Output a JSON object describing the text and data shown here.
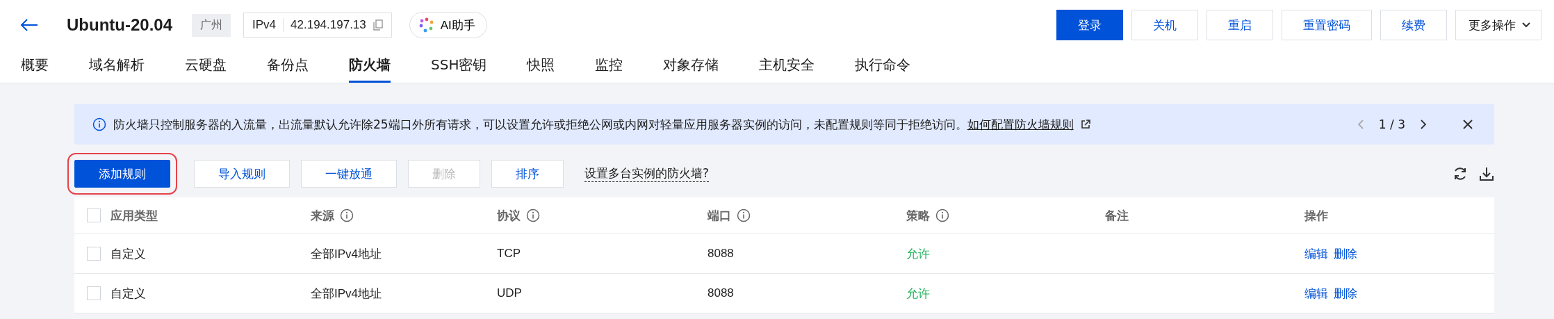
{
  "header": {
    "title": "Ubuntu-20.04",
    "region": "广州",
    "ip_label": "IPv4",
    "ip": "42.194.197.13",
    "assistant": "AI助手",
    "actions": [
      {
        "label": "登录",
        "kind": "primary"
      },
      {
        "label": "关机",
        "kind": "default"
      },
      {
        "label": "重启",
        "kind": "default"
      },
      {
        "label": "重置密码",
        "kind": "default"
      },
      {
        "label": "续费",
        "kind": "default"
      },
      {
        "label": "更多操作",
        "kind": "dropdown"
      }
    ]
  },
  "tabs": [
    {
      "label": "概要",
      "selected": false
    },
    {
      "label": "域名解析",
      "selected": false
    },
    {
      "label": "云硬盘",
      "selected": false
    },
    {
      "label": "备份点",
      "selected": false
    },
    {
      "label": "防火墙",
      "selected": true
    },
    {
      "label": "SSH密钥",
      "selected": false
    },
    {
      "label": "快照",
      "selected": false
    },
    {
      "label": "监控",
      "selected": false
    },
    {
      "label": "对象存储",
      "selected": false
    },
    {
      "label": "主机安全",
      "selected": false
    },
    {
      "label": "执行命令",
      "selected": false
    }
  ],
  "notice": {
    "text": "防火墙只控制服务器的入流量，出流量默认允许除25端口外所有请求，可以设置允许或拒绝公网或内网对轻量应用服务器实例的访问，未配置规则等同于拒绝访问。",
    "link": "如何配置防火墙规则",
    "pager": "1 / 3"
  },
  "toolbar": {
    "buttons": [
      {
        "label": "添加规则",
        "kind": "primary",
        "disabled": false,
        "highlighted": true
      },
      {
        "label": "导入规则",
        "kind": "default",
        "disabled": false,
        "highlighted": false
      },
      {
        "label": "一键放通",
        "kind": "default",
        "disabled": false,
        "highlighted": false
      },
      {
        "label": "删除",
        "kind": "default",
        "disabled": true,
        "highlighted": false
      },
      {
        "label": "排序",
        "kind": "default",
        "disabled": false,
        "highlighted": false
      }
    ],
    "link": "设置多台实例的防火墙?"
  },
  "table": {
    "all_checked": false,
    "columns": [
      {
        "label": "应用类型",
        "info": false
      },
      {
        "label": "来源",
        "info": true
      },
      {
        "label": "协议",
        "info": true
      },
      {
        "label": "端口",
        "info": true
      },
      {
        "label": "策略",
        "info": true
      },
      {
        "label": "备注",
        "info": false
      },
      {
        "label": "操作",
        "info": false
      }
    ],
    "rows": [
      {
        "checked": false,
        "app_type": "自定义",
        "source": "全部IPv4地址",
        "protocol": "TCP",
        "port": "8088",
        "policy": "允许",
        "actions": [
          "编辑",
          "删除"
        ]
      },
      {
        "checked": false,
        "app_type": "自定义",
        "source": "全部IPv4地址",
        "protocol": "UDP",
        "port": "8088",
        "policy": "允许",
        "actions": [
          "编辑",
          "删除"
        ]
      }
    ]
  }
}
